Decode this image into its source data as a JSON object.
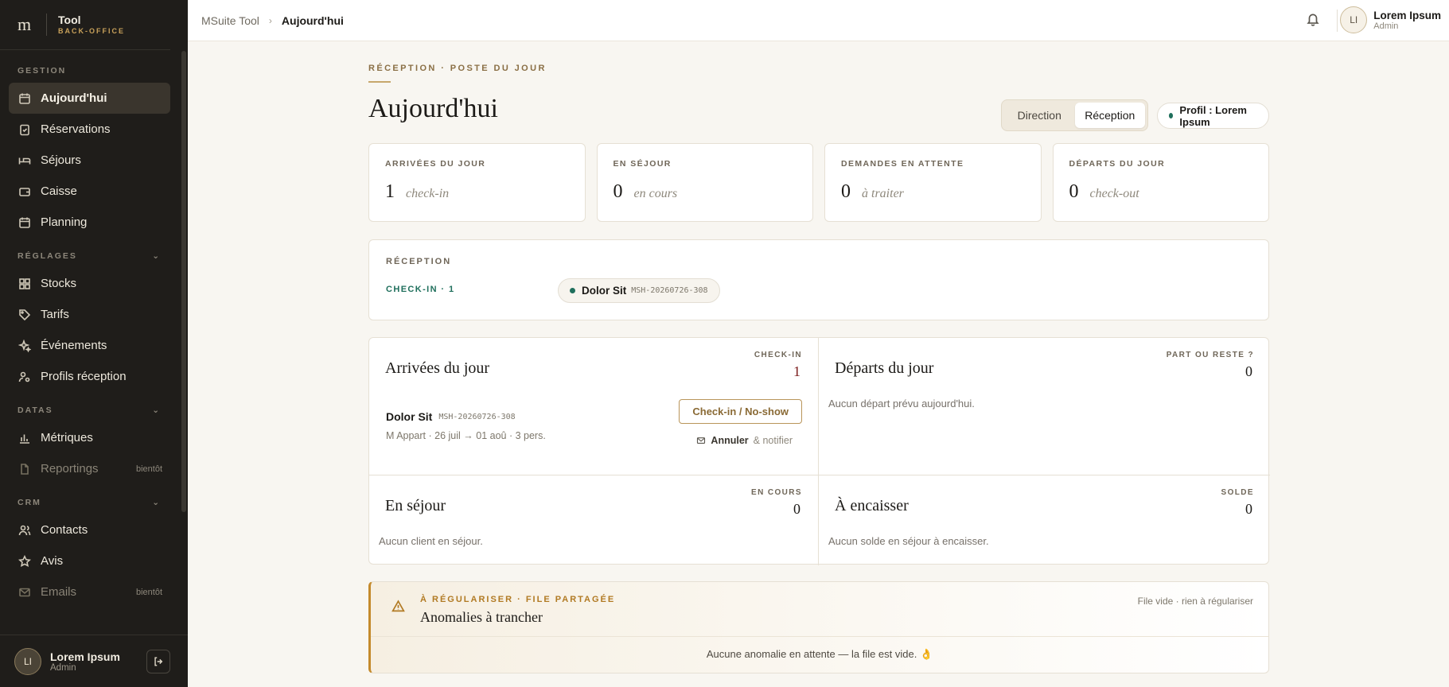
{
  "brand": {
    "logo": "m",
    "name": "Tool",
    "subtitle": "BACK-OFFICE"
  },
  "sidebar": {
    "sections": {
      "gestion": "GESTION",
      "reglages": "RÉGLAGES",
      "datas": "DATAS",
      "crm": "CRM"
    },
    "items": [
      {
        "label": "Aujourd'hui",
        "icon": "calendar-icon",
        "active": true
      },
      {
        "label": "Réservations",
        "icon": "clipboard-check-icon"
      },
      {
        "label": "Séjours",
        "icon": "bed-icon"
      },
      {
        "label": "Caisse",
        "icon": "wallet-icon"
      },
      {
        "label": "Planning",
        "icon": "calendar-icon"
      },
      {
        "label": "Stocks",
        "icon": "grid-icon"
      },
      {
        "label": "Tarifs",
        "icon": "tag-icon"
      },
      {
        "label": "Événements",
        "icon": "sparkles-icon"
      },
      {
        "label": "Profils réception",
        "icon": "user-cog-icon"
      },
      {
        "label": "Métriques",
        "icon": "bar-chart-icon"
      },
      {
        "label": "Reportings",
        "icon": "file-icon",
        "badge": "bientôt"
      },
      {
        "label": "Contacts",
        "icon": "users-icon"
      },
      {
        "label": "Avis",
        "icon": "star-icon"
      },
      {
        "label": "Emails",
        "icon": "mail-icon",
        "badge": "bientôt"
      }
    ],
    "user": {
      "initials": "LI",
      "name": "Lorem Ipsum",
      "role": "Admin"
    }
  },
  "topbar": {
    "breadcrumb": [
      "MSuite Tool",
      "Aujourd'hui"
    ],
    "user": {
      "initials": "LI",
      "name": "Lorem Ipsum",
      "role": "Admin"
    }
  },
  "page": {
    "kicker": "RÉCEPTION · POSTE DU JOUR",
    "title": "Aujourd'hui",
    "view_options": [
      "Direction",
      "Réception"
    ],
    "view_selected": "Réception",
    "profile": "Profil : Lorem Ipsum"
  },
  "kpis": [
    {
      "label": "ARRIVÉES DU JOUR",
      "value": "1",
      "sub": "check-in"
    },
    {
      "label": "EN SÉJOUR",
      "value": "0",
      "sub": "en cours"
    },
    {
      "label": "DEMANDES EN ATTENTE",
      "value": "0",
      "sub": "à traiter"
    },
    {
      "label": "DÉPARTS DU JOUR",
      "value": "0",
      "sub": "check-out"
    }
  ],
  "reception": {
    "label": "RÉCEPTION",
    "checkin": "CHECK-IN · 1",
    "guest": "Dolor Sit",
    "ref": "MSH-20260726-308"
  },
  "panels": {
    "arrivals": {
      "title": "Arrivées du jour",
      "tag": "CHECK-IN",
      "count": "1",
      "guest": "Dolor Sit",
      "ref": "MSH-20260726-308",
      "details": "M Appart · 26 juil → 01 aoû · 3 pers.",
      "action": "Check-in / No-show",
      "cancel": "Annuler",
      "cancel_suffix": "& notifier"
    },
    "departures": {
      "title": "Départs du jour",
      "tag": "PART OU RESTE ?",
      "count": "0",
      "empty": "Aucun départ prévu aujourd'hui."
    },
    "stay": {
      "title": "En séjour",
      "tag": "EN COURS",
      "count": "0",
      "empty": "Aucun client en séjour."
    },
    "collect": {
      "title": "À encaisser",
      "tag": "SOLDE",
      "count": "0",
      "empty": "Aucun solde en séjour à encaisser."
    }
  },
  "anomalies": {
    "kicker": "À RÉGULARISER · FILE PARTAGÉE",
    "title": "Anomalies à trancher",
    "status": "File vide · rien à régulariser",
    "message": "Aucune anomalie en attente — la file est vide. 👌"
  }
}
